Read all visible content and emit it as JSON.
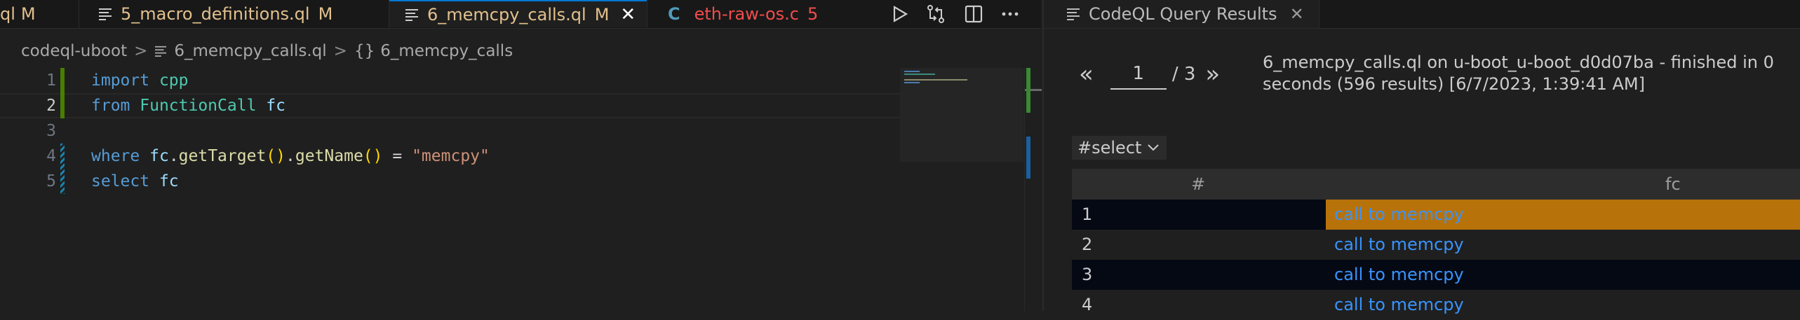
{
  "tabs": [
    {
      "label": "ql",
      "modified": "M"
    },
    {
      "label": "5_macro_definitions.ql",
      "modified": "M"
    },
    {
      "label": "6_memcpy_calls.ql",
      "modified": "M",
      "close": "✕"
    },
    {
      "label": "eth-raw-os.c",
      "icon_letter": "C",
      "problems": "5"
    }
  ],
  "breadcrumb": {
    "folder": "codeql-uboot",
    "file": "6_memcpy_calls.ql",
    "symbol_icon": "{}",
    "symbol": "6_memcpy_calls",
    "separator": ">"
  },
  "code": {
    "line_numbers": [
      "1",
      "2",
      "3",
      "4",
      "5"
    ],
    "import_kw": "import",
    "import_mod": "cpp",
    "from_kw": "from",
    "from_type": "FunctionCall",
    "from_var": "fc",
    "where_kw": "where",
    "where_var": "fc",
    "dot1": ".",
    "get_target": "getTarget",
    "parens1": "()",
    "dot2": ".",
    "get_name": "getName",
    "parens2": "()",
    "eq": "=",
    "string": "\"memcpy\"",
    "select_kw": "select",
    "select_var": "fc"
  },
  "results": {
    "tab_label": "CodeQL Query Results",
    "tab_close": "✕",
    "prev": "«",
    "next": "»",
    "page": "1",
    "page_total": "/ 3",
    "status": "6_memcpy_calls.ql on u-boot_u-boot_d0d07ba - finished in 0 seconds (596 results) [6/7/2023, 1:39:41 AM]",
    "result_set": "#select",
    "columns": [
      "#",
      "fc"
    ],
    "rows": [
      {
        "num": "1",
        "value": "call to memcpy"
      },
      {
        "num": "2",
        "value": "call to memcpy"
      },
      {
        "num": "3",
        "value": "call to memcpy"
      },
      {
        "num": "4",
        "value": "call to memcpy"
      }
    ]
  },
  "colors": {
    "accent": "#0078d4",
    "modified": "#e2c08d",
    "error": "#f14c4c",
    "link": "#3794ff",
    "selected_row": "#b8720a"
  }
}
